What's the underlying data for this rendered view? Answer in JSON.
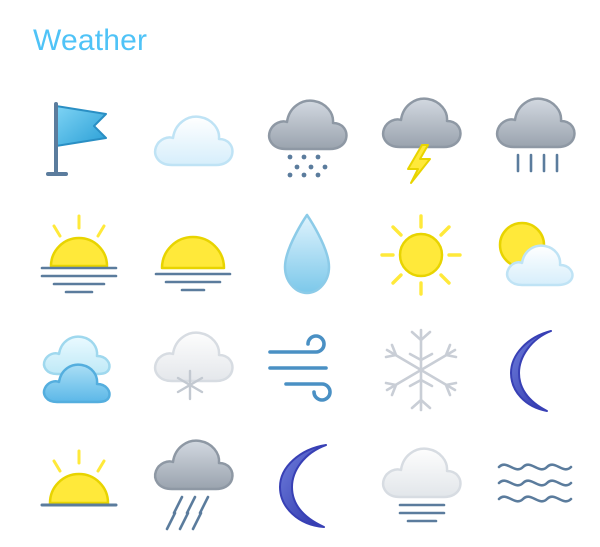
{
  "header": {
    "title": "Weather",
    "title_color": "#4fc3f7"
  },
  "palette": {
    "cloud_gray_light": "#c9ced6",
    "cloud_gray_dark": "#a3aab4",
    "cloud_white": "#f4f7fa",
    "cloud_blue_light": "#e8f6fd",
    "sun_yellow": "#ffe93a",
    "sun_outline": "#e8d400",
    "water_blue": "#9fd8f4",
    "moon_blue": "#3f51b5",
    "rain_line": "#5b7c9d",
    "wind_blue": "#4a90c4",
    "snow_gray": "#c9ced6",
    "stroke_gray": "#7f8a99"
  },
  "icons": [
    [
      {
        "name": "wind-flag-icon",
        "label": "Wind flag"
      },
      {
        "name": "cloud-icon",
        "label": "Cloud"
      },
      {
        "name": "cloud-sleet-icon",
        "label": "Cloud with sleet"
      },
      {
        "name": "cloud-lightning-icon",
        "label": "Cloud with lightning"
      },
      {
        "name": "cloud-rain-icon",
        "label": "Cloud with rain"
      }
    ],
    [
      {
        "name": "sunrise-icon",
        "label": "Sunrise"
      },
      {
        "name": "sunset-icon",
        "label": "Sunset"
      },
      {
        "name": "water-drop-icon",
        "label": "Water drop"
      },
      {
        "name": "sun-icon",
        "label": "Sun"
      },
      {
        "name": "sun-behind-cloud-icon",
        "label": "Sun behind cloud"
      }
    ],
    [
      {
        "name": "two-clouds-icon",
        "label": "Two clouds"
      },
      {
        "name": "cloud-snowflake-icon",
        "label": "Cloud with snowflake"
      },
      {
        "name": "wind-icon",
        "label": "Wind"
      },
      {
        "name": "snowflake-icon",
        "label": "Snowflake"
      },
      {
        "name": "crescent-moon-light-icon",
        "label": "Crescent moon"
      }
    ],
    [
      {
        "name": "sunrise-horizon-icon",
        "label": "Sunrise over horizon"
      },
      {
        "name": "cloud-heavy-rain-icon",
        "label": "Cloud with heavy rain"
      },
      {
        "name": "crescent-moon-icon",
        "label": "Crescent moon filled"
      },
      {
        "name": "cloud-fog-icon",
        "label": "Cloud with fog"
      },
      {
        "name": "mist-icon",
        "label": "Mist waves"
      }
    ]
  ]
}
